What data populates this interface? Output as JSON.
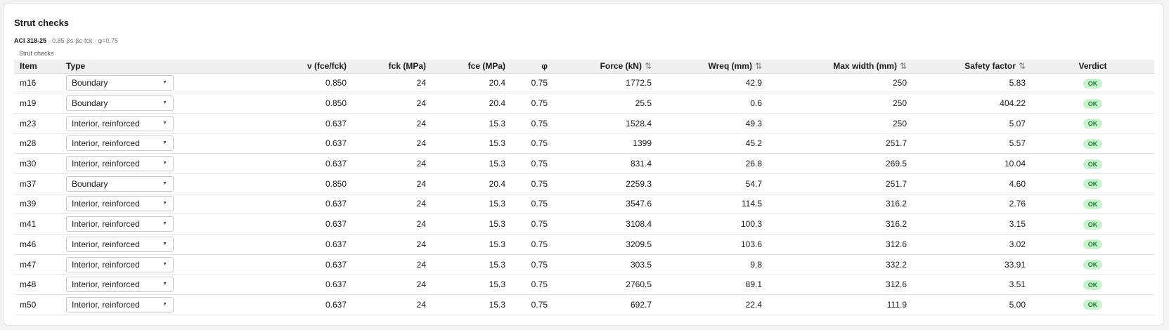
{
  "header": {
    "title": "Strut checks",
    "code": "ACI 318-25",
    "formula": " · 0.85·βs·βc·fck · φ=0.75",
    "caption": "Strut checks"
  },
  "columns": {
    "item": "Item",
    "type": "Type",
    "nu": "ν (fce/fck)",
    "fck": "fck (MPa)",
    "fce": "fce (MPa)",
    "phi": "φ",
    "force": "Force (kN)",
    "wreq": "Wreq (mm)",
    "maxw": "Max width (mm)",
    "sf": "Safety factor",
    "verdict": "Verdict",
    "sort_glyph": "⇅"
  },
  "icons": {
    "dropdown_caret": "▼",
    "sort": "sort-icon"
  },
  "colors": {
    "ok_bg": "#c9f3cf",
    "ok_text": "#1e7a32"
  },
  "rows": [
    {
      "item": "m16",
      "type": "Boundary",
      "nu": "0.850",
      "fck": "24",
      "fce": "20.4",
      "phi": "0.75",
      "force": "1772.5",
      "wreq": "42.9",
      "maxw": "250",
      "sf": "5.83",
      "verdict": "OK"
    },
    {
      "item": "m19",
      "type": "Boundary",
      "nu": "0.850",
      "fck": "24",
      "fce": "20.4",
      "phi": "0.75",
      "force": "25.5",
      "wreq": "0.6",
      "maxw": "250",
      "sf": "404.22",
      "verdict": "OK"
    },
    {
      "item": "m23",
      "type": "Interior, reinforced",
      "nu": "0.637",
      "fck": "24",
      "fce": "15.3",
      "phi": "0.75",
      "force": "1528.4",
      "wreq": "49.3",
      "maxw": "250",
      "sf": "5.07",
      "verdict": "OK"
    },
    {
      "item": "m28",
      "type": "Interior, reinforced",
      "nu": "0.637",
      "fck": "24",
      "fce": "15.3",
      "phi": "0.75",
      "force": "1399",
      "wreq": "45.2",
      "maxw": "251.7",
      "sf": "5.57",
      "verdict": "OK"
    },
    {
      "item": "m30",
      "type": "Interior, reinforced",
      "nu": "0.637",
      "fck": "24",
      "fce": "15.3",
      "phi": "0.75",
      "force": "831.4",
      "wreq": "26.8",
      "maxw": "269.5",
      "sf": "10.04",
      "verdict": "OK"
    },
    {
      "item": "m37",
      "type": "Boundary",
      "nu": "0.850",
      "fck": "24",
      "fce": "20.4",
      "phi": "0.75",
      "force": "2259.3",
      "wreq": "54.7",
      "maxw": "251.7",
      "sf": "4.60",
      "verdict": "OK"
    },
    {
      "item": "m39",
      "type": "Interior, reinforced",
      "nu": "0.637",
      "fck": "24",
      "fce": "15.3",
      "phi": "0.75",
      "force": "3547.6",
      "wreq": "114.5",
      "maxw": "316.2",
      "sf": "2.76",
      "verdict": "OK"
    },
    {
      "item": "m41",
      "type": "Interior, reinforced",
      "nu": "0.637",
      "fck": "24",
      "fce": "15.3",
      "phi": "0.75",
      "force": "3108.4",
      "wreq": "100.3",
      "maxw": "316.2",
      "sf": "3.15",
      "verdict": "OK"
    },
    {
      "item": "m46",
      "type": "Interior, reinforced",
      "nu": "0.637",
      "fck": "24",
      "fce": "15.3",
      "phi": "0.75",
      "force": "3209.5",
      "wreq": "103.6",
      "maxw": "312.6",
      "sf": "3.02",
      "verdict": "OK"
    },
    {
      "item": "m47",
      "type": "Interior, reinforced",
      "nu": "0.637",
      "fck": "24",
      "fce": "15.3",
      "phi": "0.75",
      "force": "303.5",
      "wreq": "9.8",
      "maxw": "332.2",
      "sf": "33.91",
      "verdict": "OK"
    },
    {
      "item": "m48",
      "type": "Interior, reinforced",
      "nu": "0.637",
      "fck": "24",
      "fce": "15.3",
      "phi": "0.75",
      "force": "2760.5",
      "wreq": "89.1",
      "maxw": "312.6",
      "sf": "3.51",
      "verdict": "OK"
    },
    {
      "item": "m50",
      "type": "Interior, reinforced",
      "nu": "0.637",
      "fck": "24",
      "fce": "15.3",
      "phi": "0.75",
      "force": "692.7",
      "wreq": "22.4",
      "maxw": "111.9",
      "sf": "5.00",
      "verdict": "OK"
    }
  ]
}
